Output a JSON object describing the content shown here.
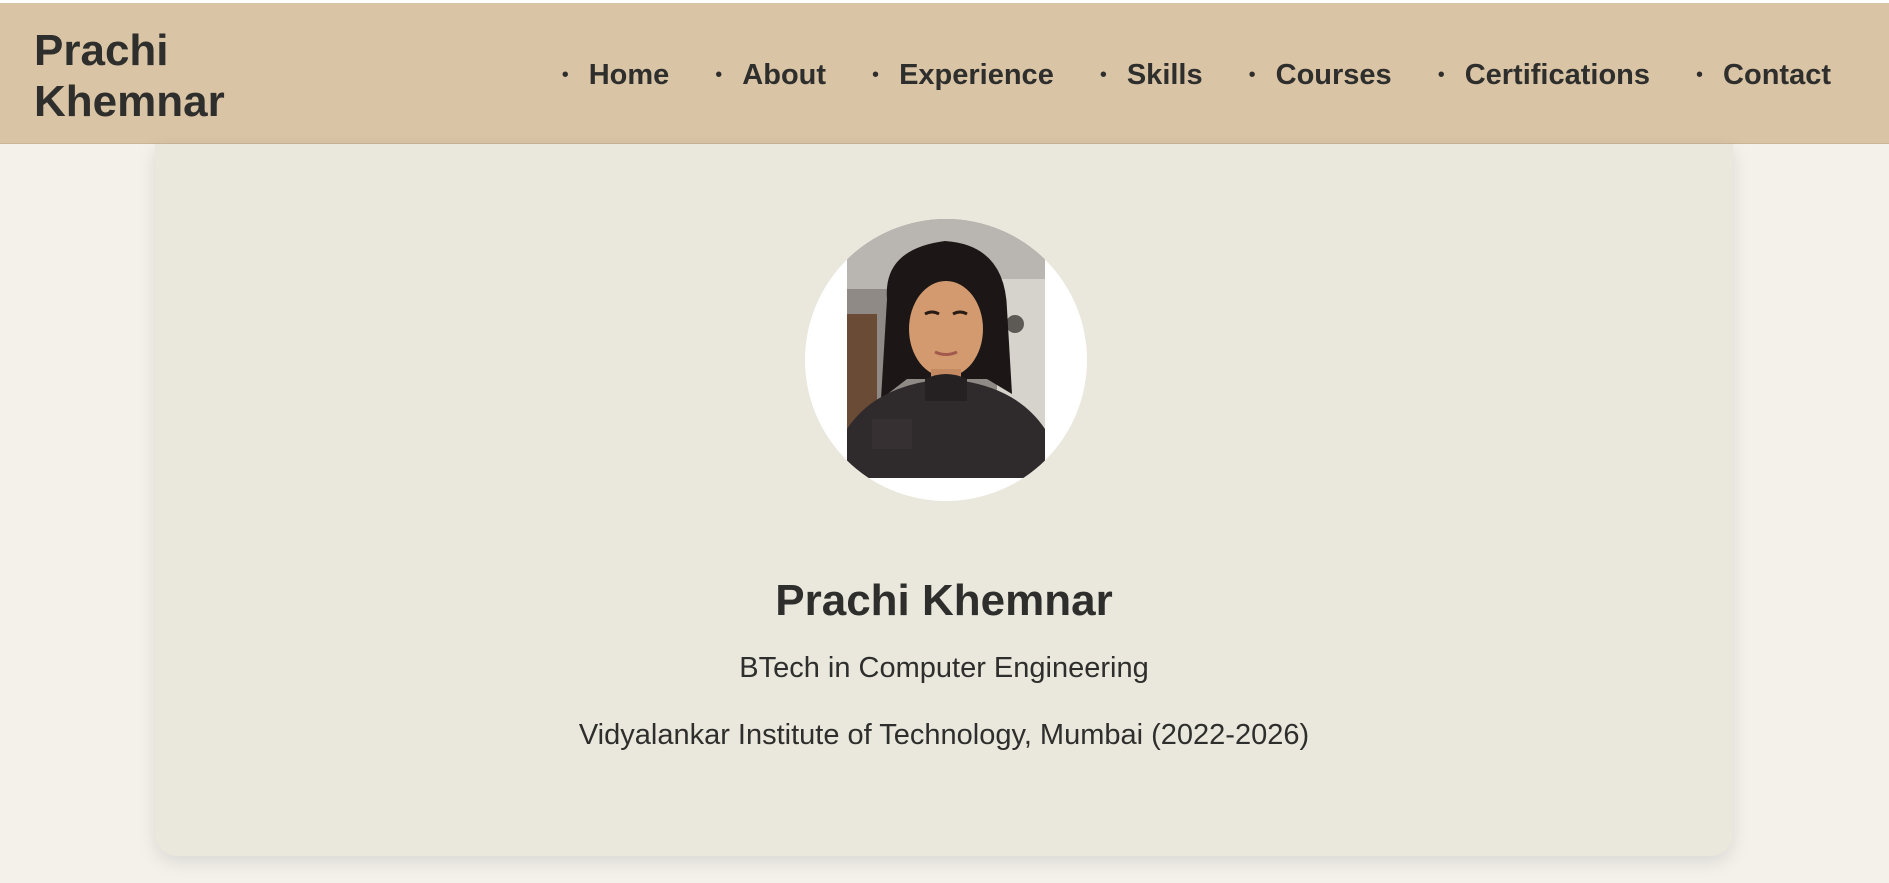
{
  "header": {
    "brand": "Prachi Khemnar",
    "nav": [
      {
        "label": "Home"
      },
      {
        "label": "About"
      },
      {
        "label": "Experience"
      },
      {
        "label": "Skills"
      },
      {
        "label": "Courses"
      },
      {
        "label": "Certifications"
      },
      {
        "label": "Contact"
      }
    ],
    "bullet": "•"
  },
  "hero": {
    "photo_alt": "Profile photo of Prachi Khemnar",
    "name": "Prachi Khemnar",
    "degree": "BTech in Computer Engineering",
    "institute": "Vidyalankar Institute of Technology, Mumbai (2022-2026)"
  },
  "colors": {
    "header_bg": "#dac4a6",
    "page_bg": "#f3f1ea",
    "card_bg": "#eae7dc",
    "text": "#2e2e2c"
  }
}
